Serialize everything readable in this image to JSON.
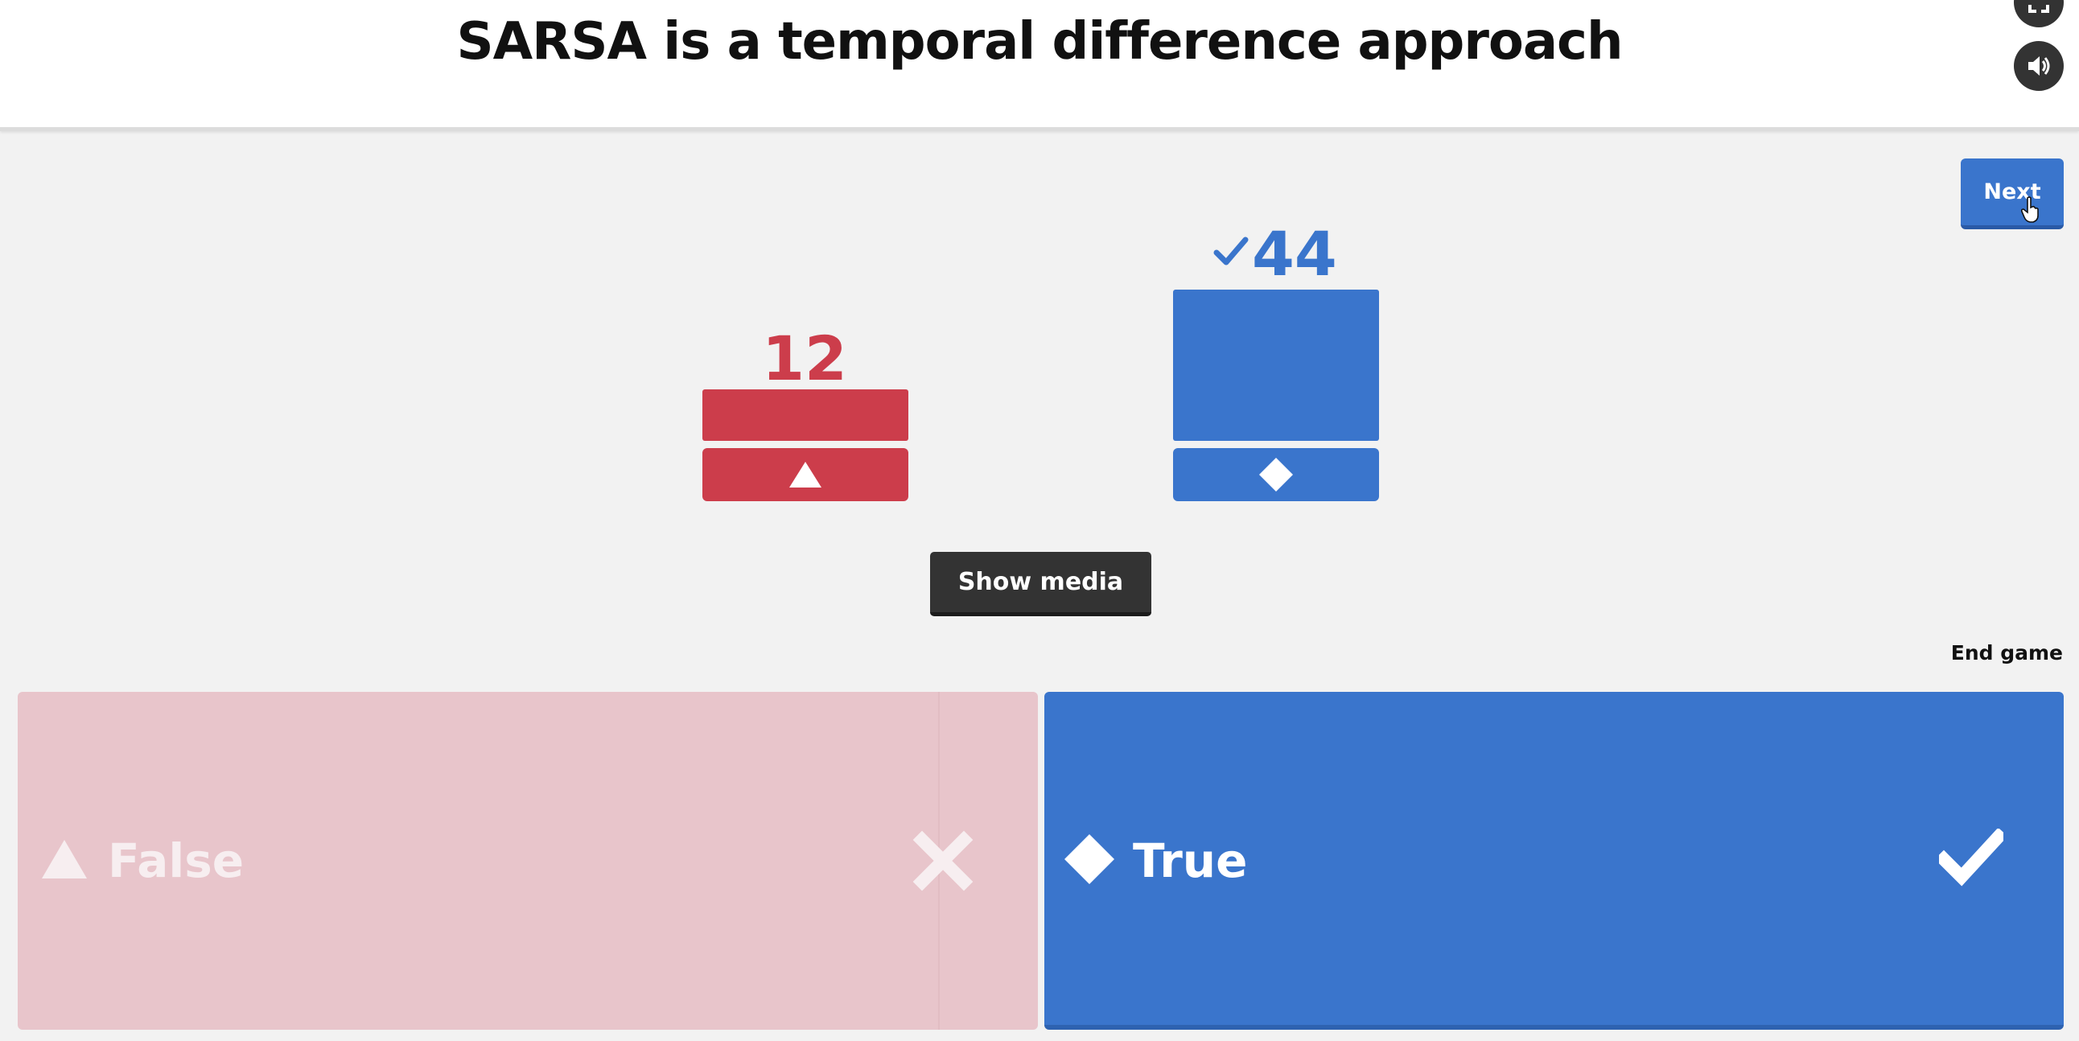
{
  "question": {
    "title": "SARSA is a temporal difference approach"
  },
  "controls": {
    "next_label": "Next",
    "show_media_label": "Show media",
    "end_game_label": "End game",
    "icons": {
      "fullscreen": "fullscreen-icon",
      "sound": "speaker-icon",
      "cursor": "hand-pointer-icon"
    }
  },
  "results": {
    "false": {
      "count": "12",
      "shape": "triangle-icon",
      "color": "#cc3d4b",
      "correct": false
    },
    "true": {
      "count": "44",
      "shape": "diamond-icon",
      "color": "#3a75cc",
      "correct": true
    }
  },
  "answers": [
    {
      "label": "False",
      "shape": "triangle-icon",
      "mark": "cross-icon",
      "correct": false,
      "color": "#e8c5cb"
    },
    {
      "label": "True",
      "shape": "diamond-icon",
      "mark": "checkmark-icon",
      "correct": true,
      "color": "#3a75cc"
    }
  ]
}
